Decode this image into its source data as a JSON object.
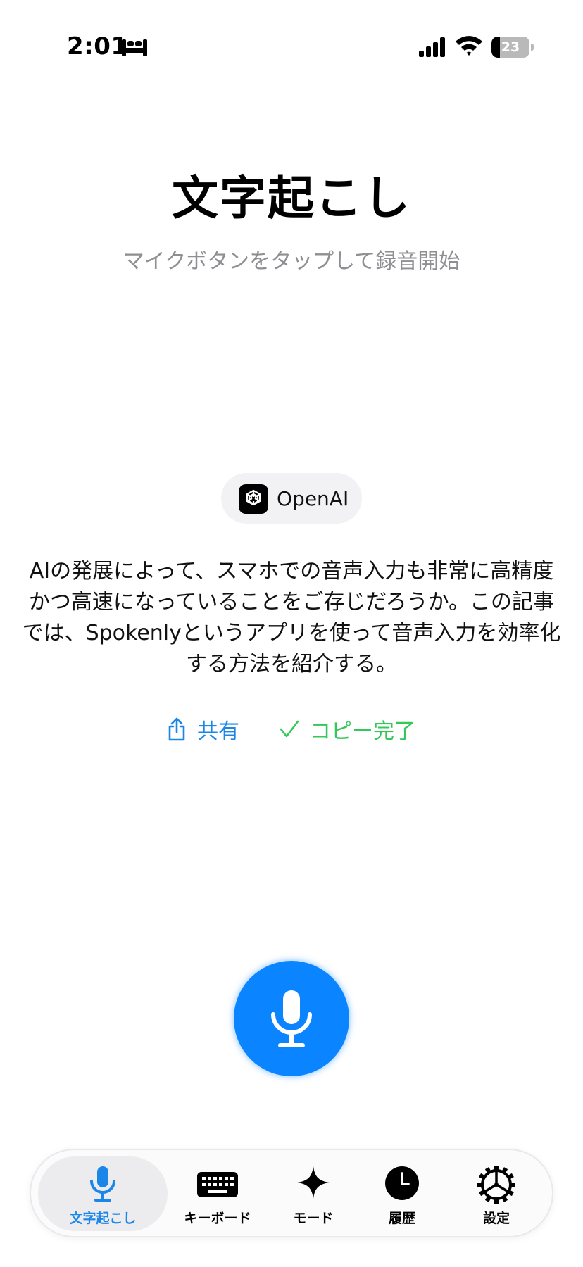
{
  "status_bar": {
    "time": "2:01",
    "focus_icon": "bed-icon",
    "battery_level": "23",
    "battery_fraction": 0.23
  },
  "header": {
    "title": "文字起こし",
    "subtitle": "マイクボタンをタップして録音開始"
  },
  "provider": {
    "name": "OpenAI",
    "icon": "openai-logo-icon"
  },
  "transcript": {
    "text": "AIの発展によって、スマホでの音声入力も非常に高精度かつ高速になっていることをご存じだろうか。この記事では、Spokenlyというアプリを使って音声入力を効率化する方法を紹介する。"
  },
  "actions": {
    "share_label": "共有",
    "copy_label": "コピー完了"
  },
  "colors": {
    "accent": "#0a84ff",
    "link": "#1a86e8",
    "success": "#34c759",
    "subtitle_gray": "#8e8e93"
  },
  "tab_bar": {
    "tabs": [
      {
        "label": "文字起こし",
        "icon": "mic-icon",
        "active": true
      },
      {
        "label": "キーボード",
        "icon": "keyboard-icon",
        "active": false
      },
      {
        "label": "モード",
        "icon": "sparkle-icon",
        "active": false
      },
      {
        "label": "履歴",
        "icon": "clock-icon",
        "active": false
      },
      {
        "label": "設定",
        "icon": "gear-icon",
        "active": false
      }
    ]
  }
}
